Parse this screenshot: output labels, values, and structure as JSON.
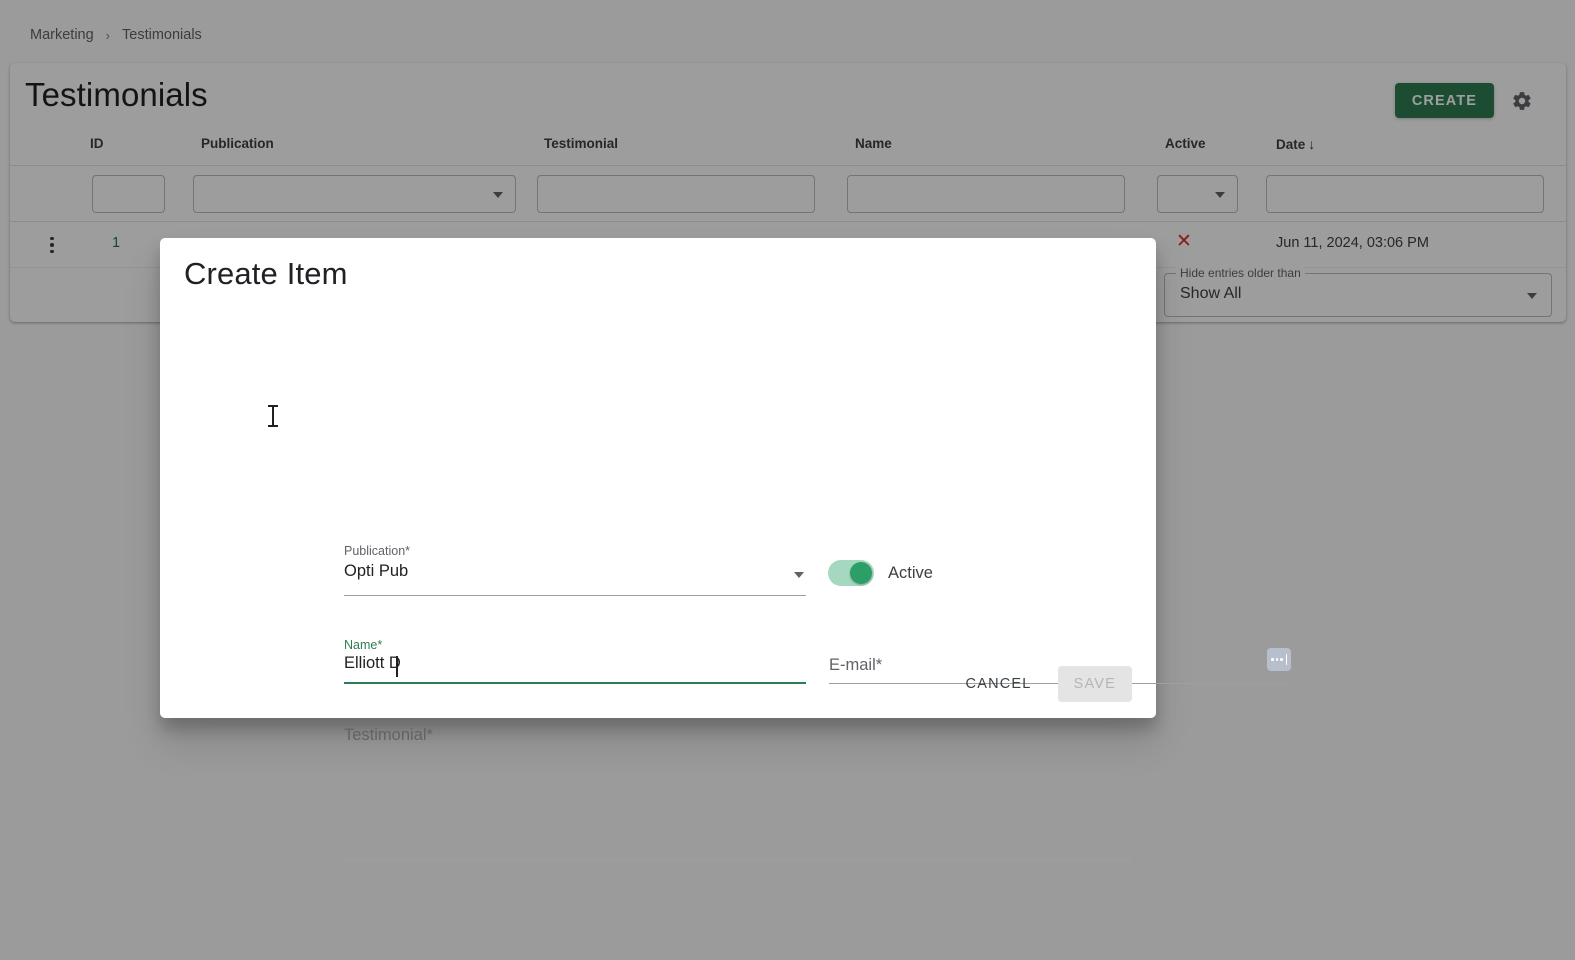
{
  "breadcrumb": {
    "items": [
      "Marketing",
      "Testimonials"
    ],
    "separator": "›"
  },
  "page": {
    "title": "Testimonials",
    "create_label": "CREATE",
    "settings_icon": "gear-icon"
  },
  "table": {
    "columns": [
      {
        "key": "id",
        "label": "ID"
      },
      {
        "key": "publication",
        "label": "Publication"
      },
      {
        "key": "testimonial",
        "label": "Testimonial"
      },
      {
        "key": "name",
        "label": "Name"
      },
      {
        "key": "active",
        "label": "Active"
      },
      {
        "key": "date",
        "label": "Date"
      }
    ],
    "sorted_column": "Date",
    "sort_direction_icon": "↓",
    "filters": {
      "id": "",
      "publication": "",
      "testimonial": "",
      "name": "",
      "active": "",
      "date": ""
    },
    "rows": [
      {
        "id": "1",
        "publication": "",
        "testimonial": "",
        "name": "",
        "active_icon": "✕",
        "date": "Jun 11, 2024, 03:06 PM"
      }
    ]
  },
  "hide_entries": {
    "legend": "Hide entries older than",
    "value": "Show All"
  },
  "dialog": {
    "title": "Create Item",
    "publication": {
      "label": "Publication*",
      "value": "Opti Pub"
    },
    "active": {
      "label": "Active",
      "checked": true
    },
    "name": {
      "label": "Name*",
      "value": "Elliott D",
      "focused": true
    },
    "email": {
      "label": "E-mail*",
      "value": "",
      "autofill_icon": "autofill-dots-icon"
    },
    "testimonial": {
      "label": "Testimonial*",
      "value": ""
    },
    "cancel_label": "CANCEL",
    "save_label": "SAVE",
    "save_disabled": true
  },
  "colors": {
    "brand_green": "#2e7d52",
    "toggle_track": "#a5d9bf",
    "toggle_knob": "#2e9e68",
    "danger_red": "#d93025",
    "id_green": "#1f7a45"
  }
}
